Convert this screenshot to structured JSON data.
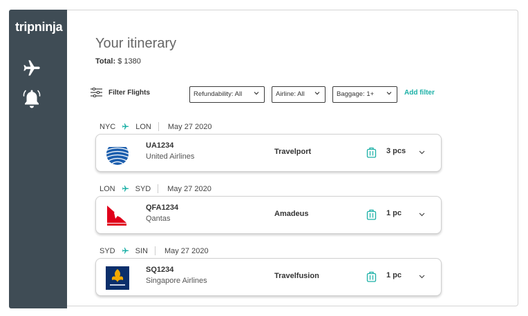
{
  "app": {
    "brand": "tripninja"
  },
  "sidebar": {
    "items": [
      {
        "name": "flights",
        "icon": "airplane-icon"
      },
      {
        "name": "alerts",
        "icon": "bell-icon"
      }
    ],
    "color": "#3f4c55"
  },
  "header": {
    "title": "Your itinerary",
    "total_label": "Total:",
    "total_value": "$ 1380"
  },
  "filters": {
    "label": "Filter Flights",
    "dropdowns": [
      {
        "label": "Refundability: All"
      },
      {
        "label": "Airline: All"
      },
      {
        "label": "Baggage: 1+"
      }
    ],
    "add_filter": "Add filter"
  },
  "accent": "#1bb0a6",
  "segments": [
    {
      "from": "NYC",
      "to": "LON",
      "date": "May 27 2020",
      "flight_code": "UA1234",
      "airline": "United Airlines",
      "provider": "Travelport",
      "baggage": "3 pcs",
      "logo": "united-airlines-logo"
    },
    {
      "from": "LON",
      "to": "SYD",
      "date": "May 27 2020",
      "flight_code": "QFA1234",
      "airline": "Qantas",
      "provider": "Amadeus",
      "baggage": "1 pc",
      "logo": "qantas-logo"
    },
    {
      "from": "SYD",
      "to": "SIN",
      "date": "May 27 2020",
      "flight_code": "SQ1234",
      "airline": "Singapore Airlines",
      "provider": "Travelfusion",
      "baggage": "1 pc",
      "logo": "singapore-airlines-logo"
    }
  ]
}
